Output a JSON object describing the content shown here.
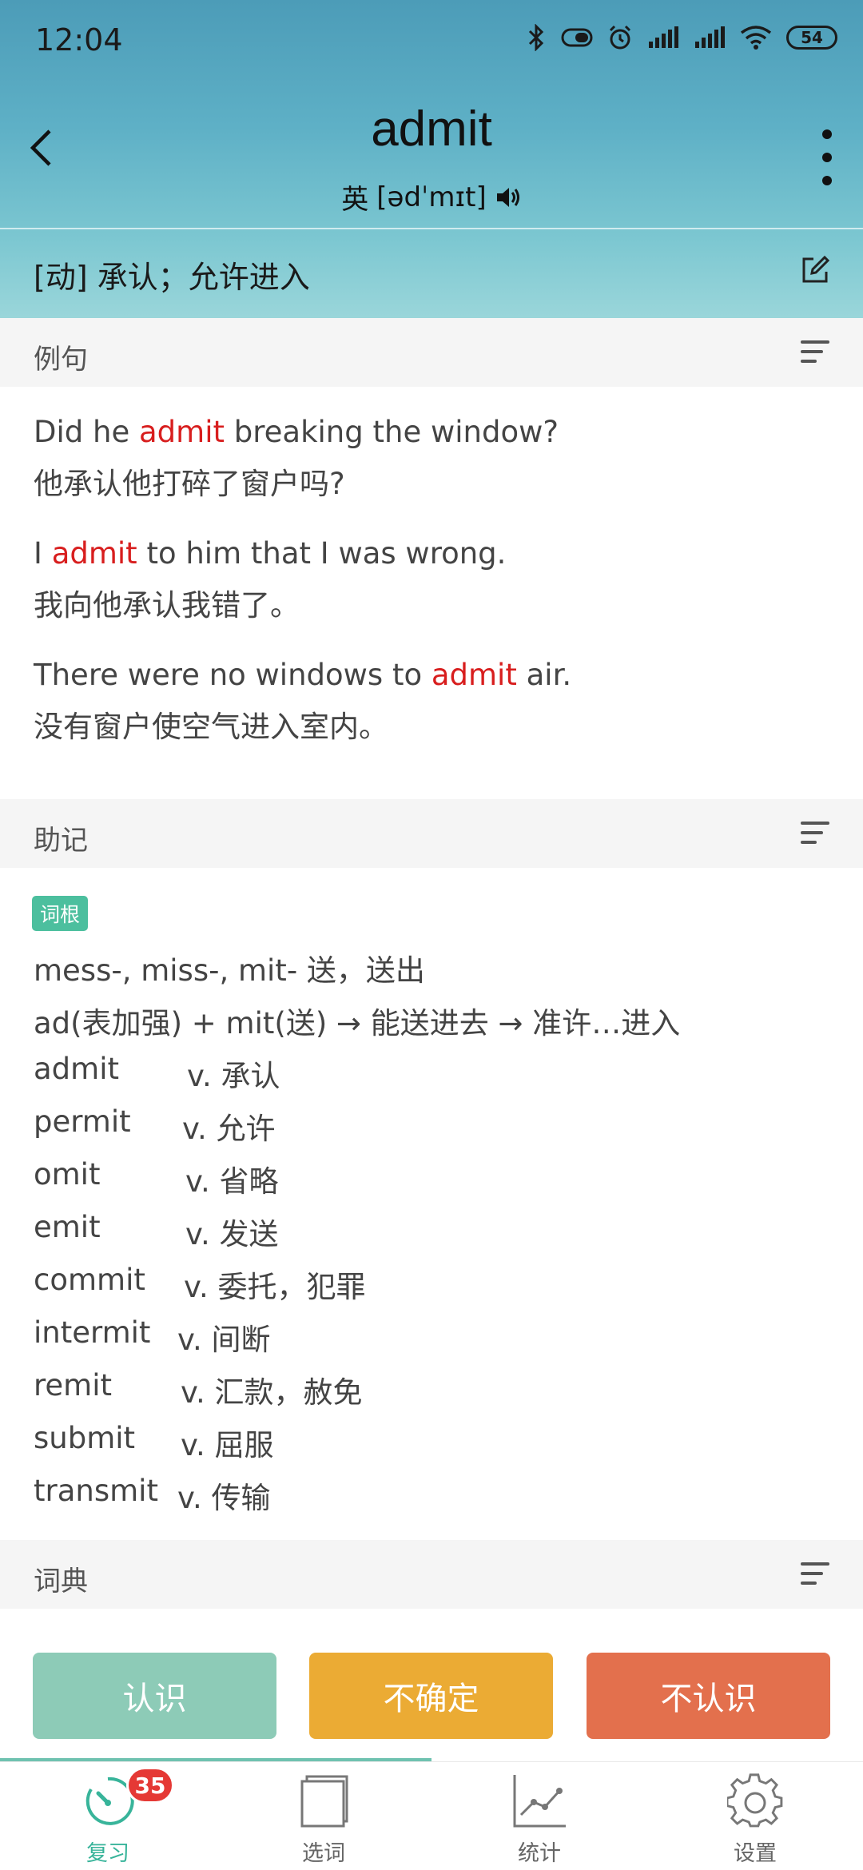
{
  "status": {
    "time": "12:04",
    "battery": "54"
  },
  "word": {
    "text": "admit",
    "phonetic_prefix": "英",
    "phonetic": "[ədˈmɪt]"
  },
  "definition": "[动] 承认；允许进入",
  "sections": {
    "examples": "例句",
    "mnemonic": "助记",
    "dictionary": "词典"
  },
  "examples": [
    {
      "en_pre": "Did he ",
      "hl": "admit",
      "en_post": " breaking the window?",
      "zh": "他承认他打碎了窗户吗?"
    },
    {
      "en_pre": "I ",
      "hl": "admit",
      "en_post": " to him that I was wrong.",
      "zh": "我向他承认我错了。"
    },
    {
      "en_pre": "There were no windows to ",
      "hl": "admit",
      "en_post": " air.",
      "zh": "没有窗户使空气进入室内。"
    }
  ],
  "mnemonic": {
    "tag": "词根",
    "line1": "mess-, miss-, mit- 送，送出",
    "line2": "ad(表加强) + mit(送) → 能送进去 → 准许…进入",
    "related": [
      {
        "word": "admit",
        "def": "v. 承认"
      },
      {
        "word": "permit",
        "def": "v. 允许"
      },
      {
        "word": "omit",
        "def": "v. 省略"
      },
      {
        "word": "emit",
        "def": "v. 发送"
      },
      {
        "word": "commit",
        "def": "v. 委托，犯罪"
      },
      {
        "word": "intermit",
        "def": "v. 间断"
      },
      {
        "word": "remit",
        "def": "v. 汇款，赦免"
      },
      {
        "word": "submit",
        "def": "v. 屈服"
      },
      {
        "word": "transmit",
        "def": "v. 传输"
      }
    ]
  },
  "actions": {
    "know": "认识",
    "unsure": "不确定",
    "dont_know": "不认识"
  },
  "tabs": [
    {
      "label": "复习",
      "badge": "35",
      "icon": "review-dial-icon"
    },
    {
      "label": "选词",
      "icon": "book-icon"
    },
    {
      "label": "统计",
      "icon": "chart-icon"
    },
    {
      "label": "设置",
      "icon": "gear-icon"
    }
  ],
  "colors": {
    "accent": "#38b49a",
    "highlight": "#d81e1e",
    "know": "#8dcbb7",
    "unsure": "#ebab34",
    "dont_know": "#e3704d"
  }
}
